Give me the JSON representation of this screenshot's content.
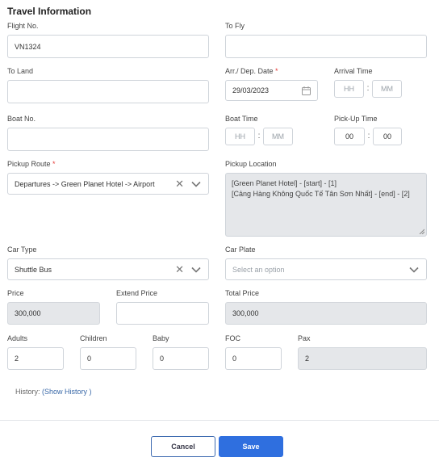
{
  "section_title": "Travel Information",
  "labels": {
    "flight_no": "Flight No.",
    "to_fly": "To Fly",
    "to_land": "To Land",
    "arr_dep_date": "Arr./ Dep. Date",
    "arrival_time": "Arrival Time",
    "boat_no": "Boat No.",
    "boat_time": "Boat Time",
    "pickup_time": "Pick-Up Time",
    "pickup_route": "Pickup Route",
    "pickup_location": "Pickup Location",
    "car_type": "Car Type",
    "car_plate": "Car Plate",
    "price": "Price",
    "extend_price": "Extend Price",
    "total_price": "Total Price",
    "adults": "Adults",
    "children": "Children",
    "baby": "Baby",
    "foc": "FOC",
    "pax": "Pax",
    "required_mark": "*"
  },
  "fields": {
    "flight_no": "VN1324",
    "to_fly": "",
    "to_land": "",
    "arr_dep_date": "29/03/2023",
    "arrival_time_hh_placeholder": "HH",
    "arrival_time_mm_placeholder": "MM",
    "boat_no": "",
    "boat_time_hh_placeholder": "HH",
    "boat_time_mm_placeholder": "MM",
    "pickup_time_hh": "00",
    "pickup_time_mm": "00",
    "pickup_route": "Departures -> Green Planet Hotel -> Airport",
    "pickup_location_line1": "[Green Planet Hotel] - [start] - [1]",
    "pickup_location_line2": "[Cảng Hàng Không Quốc Tế Tân Sơn Nhất] - [end] - [2]",
    "car_type": "Shuttle Bus",
    "car_plate_placeholder": "Select an option",
    "price": "300,000",
    "extend_price": "",
    "total_price": "300,000",
    "adults": "2",
    "children": "0",
    "baby": "0",
    "foc": "0",
    "pax": "2",
    "time_separator": ":"
  },
  "history": {
    "label": "History:",
    "link": "(Show History )"
  },
  "buttons": {
    "cancel": "Cancel",
    "save": "Save"
  },
  "colors": {
    "primary": "#2f6fdf",
    "required": "#e53935",
    "readonly_bg": "#e5e7ea"
  }
}
